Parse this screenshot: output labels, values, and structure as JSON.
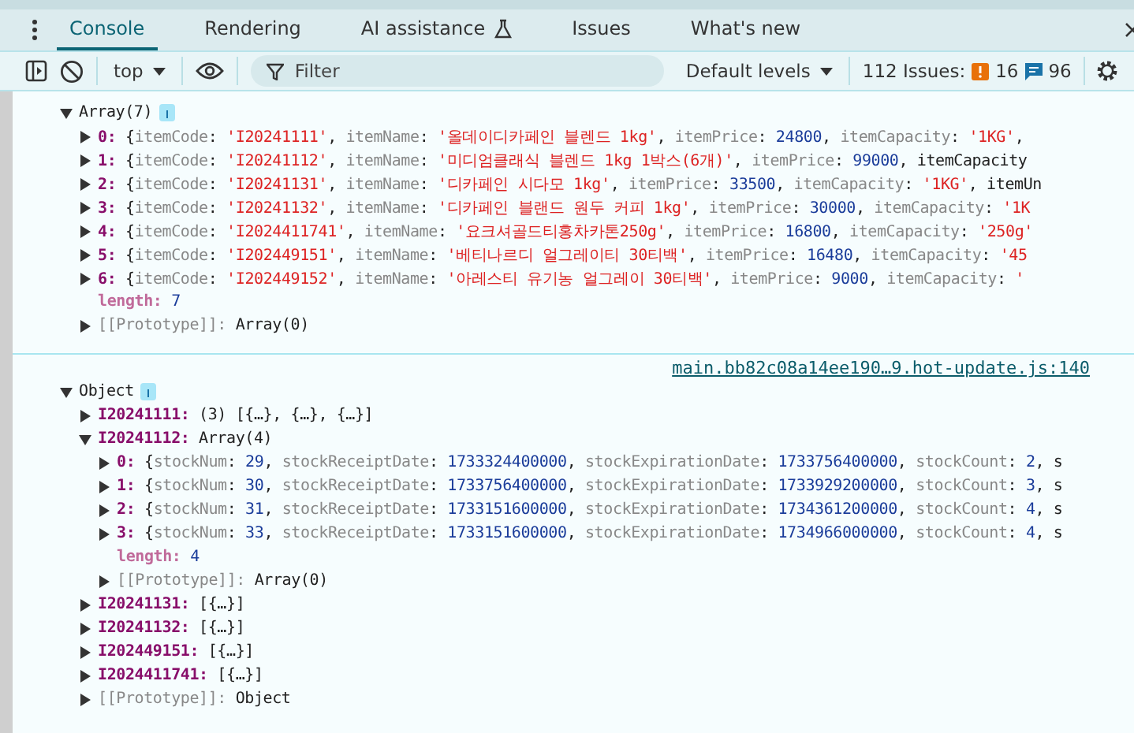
{
  "tabs": [
    {
      "label": "Console",
      "selected": true,
      "kind": "plain"
    },
    {
      "label": "Rendering",
      "selected": false,
      "kind": "plain"
    },
    {
      "label": "AI assistance",
      "selected": false,
      "kind": "experimental"
    },
    {
      "label": "Issues",
      "selected": false,
      "kind": "plain"
    },
    {
      "label": "What's new",
      "selected": false,
      "kind": "plain"
    }
  ],
  "toolbar": {
    "context": "top",
    "filter_placeholder": "Filter",
    "levels": "Default levels",
    "issues_label": "112 Issues:",
    "error_count": "16",
    "message_count": "96"
  },
  "messages": [
    {
      "root": {
        "kind": "root",
        "value": "Array(7)",
        "expanded": true,
        "children": [
          {
            "kind": "index",
            "key": "0:",
            "value": "{itemCode: 'I20241111', itemName: '올데이디카페인 블렌드 1kg', itemPrice: 24800, itemCapacity: '1KG',",
            "expanded": false
          },
          {
            "kind": "index",
            "key": "1:",
            "value": "{itemCode: 'I20241112', itemName: '미디엄클래식 블렌드 1kg 1박스(6개)', itemPrice: 99000, itemCapacity",
            "expanded": false
          },
          {
            "kind": "index",
            "key": "2:",
            "value": "{itemCode: 'I20241131', itemName: '디카페인 시다모 1kg', itemPrice: 33500, itemCapacity: '1KG', itemUn",
            "expanded": false
          },
          {
            "kind": "index",
            "key": "3:",
            "value": "{itemCode: 'I20241132', itemName: '디카페인 블랜드 원두 커피 1kg', itemPrice: 30000, itemCapacity: '1K",
            "expanded": false
          },
          {
            "kind": "index",
            "key": "4:",
            "value": "{itemCode: 'I2024411741', itemName: '요크셔골드티홍차카톤250g', itemPrice: 16800, itemCapacity: '250g'",
            "expanded": false
          },
          {
            "kind": "index",
            "key": "5:",
            "value": "{itemCode: 'I202449151', itemName: '베티나르디 얼그레이티 30티백', itemPrice: 16480, itemCapacity: '45",
            "expanded": false
          },
          {
            "kind": "index",
            "key": "6:",
            "value": "{itemCode: 'I202449152', itemName: '아레스티 유기농 얼그레이 30티백', itemPrice: 9000, itemCapacity: '",
            "expanded": false
          },
          {
            "kind": "length",
            "key": "length:",
            "value": "7"
          },
          {
            "kind": "internal",
            "key": "[[Prototype]]:",
            "value": "Array(0)",
            "expanded": false
          }
        ]
      }
    },
    {
      "source": "main.bb82c08a14ee190…9.hot-update.js:140",
      "root": {
        "kind": "root",
        "value": "Object",
        "expanded": true,
        "children": [
          {
            "kind": "index",
            "key": "I20241111:",
            "value": "(3) [{…}, {…}, {…}]",
            "expanded": false
          },
          {
            "kind": "index",
            "key": "I20241112:",
            "value": "Array(4)",
            "expanded": true,
            "children": [
              {
                "kind": "index",
                "key": "0:",
                "value": "{stockNum: 29, stockReceiptDate: 1733324400000, stockExpirationDate: 1733756400000, stockCount: 2, s",
                "expanded": false
              },
              {
                "kind": "index",
                "key": "1:",
                "value": "{stockNum: 30, stockReceiptDate: 1733756400000, stockExpirationDate: 1733929200000, stockCount: 3, s",
                "expanded": false
              },
              {
                "kind": "index",
                "key": "2:",
                "value": "{stockNum: 31, stockReceiptDate: 1733151600000, stockExpirationDate: 1734361200000, stockCount: 4, s",
                "expanded": false
              },
              {
                "kind": "index",
                "key": "3:",
                "value": "{stockNum: 33, stockReceiptDate: 1733151600000, stockExpirationDate: 1734966000000, stockCount: 4, s",
                "expanded": false
              },
              {
                "kind": "length",
                "key": "length:",
                "value": "4"
              },
              {
                "kind": "internal",
                "key": "[[Prototype]]:",
                "value": "Array(0)",
                "expanded": false
              }
            ]
          },
          {
            "kind": "index",
            "key": "I20241131:",
            "value": "[{…}]",
            "expanded": false
          },
          {
            "kind": "index",
            "key": "I20241132:",
            "value": "[{…}]",
            "expanded": false
          },
          {
            "kind": "index",
            "key": "I202449151:",
            "value": "[{…}]",
            "expanded": false
          },
          {
            "kind": "index",
            "key": "I2024411741:",
            "value": "[{…}]",
            "expanded": false
          },
          {
            "kind": "internal",
            "key": "[[Prototype]]:",
            "value": "Object",
            "expanded": false
          }
        ]
      }
    }
  ]
}
